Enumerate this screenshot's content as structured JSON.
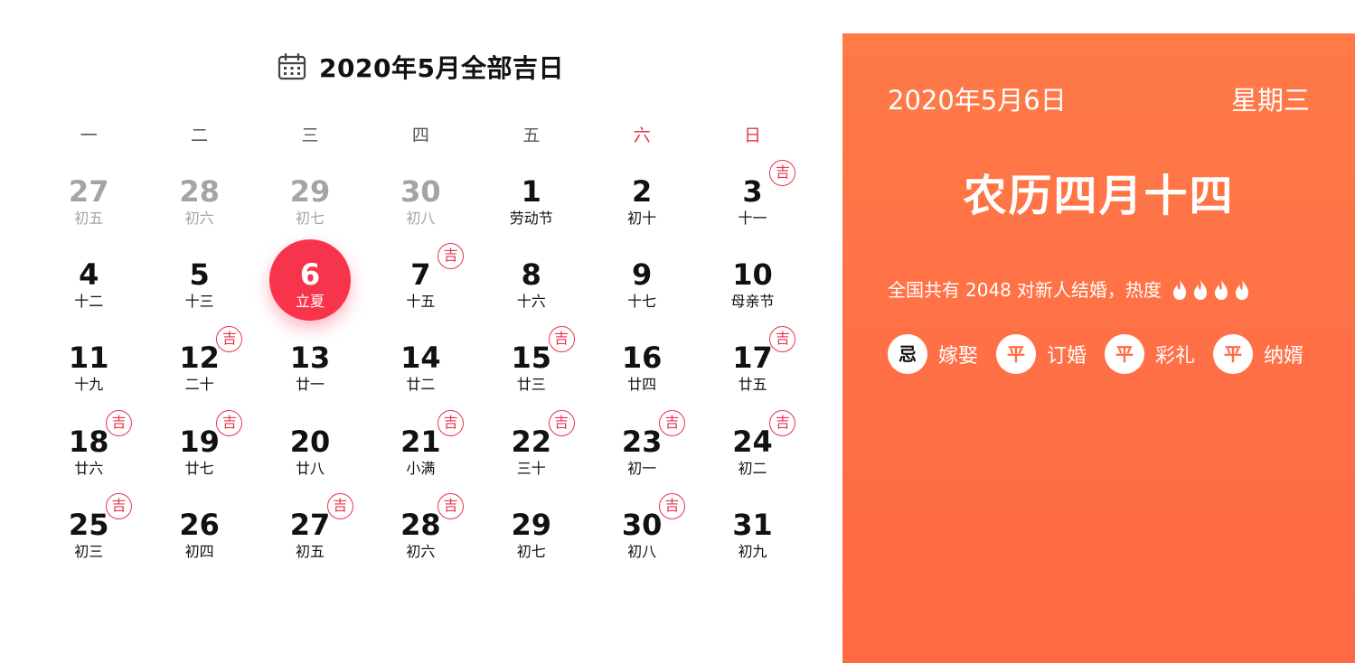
{
  "calendar": {
    "title": "2020年5月全部吉日",
    "weekdays": [
      "一",
      "二",
      "三",
      "四",
      "五",
      "六",
      "日"
    ],
    "ji_label": "吉",
    "days": [
      {
        "num": "27",
        "sub": "初五",
        "other": true,
        "ji": false
      },
      {
        "num": "28",
        "sub": "初六",
        "other": true,
        "ji": false
      },
      {
        "num": "29",
        "sub": "初七",
        "other": true,
        "ji": false
      },
      {
        "num": "30",
        "sub": "初八",
        "other": true,
        "ji": false
      },
      {
        "num": "1",
        "sub": "劳动节",
        "other": false,
        "ji": false
      },
      {
        "num": "2",
        "sub": "初十",
        "other": false,
        "ji": false
      },
      {
        "num": "3",
        "sub": "十一",
        "other": false,
        "ji": true
      },
      {
        "num": "4",
        "sub": "十二",
        "other": false,
        "ji": false
      },
      {
        "num": "5",
        "sub": "十三",
        "other": false,
        "ji": false
      },
      {
        "num": "6",
        "sub": "立夏",
        "other": false,
        "ji": false,
        "today": true
      },
      {
        "num": "7",
        "sub": "十五",
        "other": false,
        "ji": true
      },
      {
        "num": "8",
        "sub": "十六",
        "other": false,
        "ji": false
      },
      {
        "num": "9",
        "sub": "十七",
        "other": false,
        "ji": false
      },
      {
        "num": "10",
        "sub": "母亲节",
        "other": false,
        "ji": false
      },
      {
        "num": "11",
        "sub": "十九",
        "other": false,
        "ji": false
      },
      {
        "num": "12",
        "sub": "二十",
        "other": false,
        "ji": true
      },
      {
        "num": "13",
        "sub": "廿一",
        "other": false,
        "ji": false
      },
      {
        "num": "14",
        "sub": "廿二",
        "other": false,
        "ji": false
      },
      {
        "num": "15",
        "sub": "廿三",
        "other": false,
        "ji": true
      },
      {
        "num": "16",
        "sub": "廿四",
        "other": false,
        "ji": false
      },
      {
        "num": "17",
        "sub": "廿五",
        "other": false,
        "ji": true
      },
      {
        "num": "18",
        "sub": "廿六",
        "other": false,
        "ji": true
      },
      {
        "num": "19",
        "sub": "廿七",
        "other": false,
        "ji": true
      },
      {
        "num": "20",
        "sub": "廿八",
        "other": false,
        "ji": false
      },
      {
        "num": "21",
        "sub": "小满",
        "other": false,
        "ji": true
      },
      {
        "num": "22",
        "sub": "三十",
        "other": false,
        "ji": true
      },
      {
        "num": "23",
        "sub": "初一",
        "other": false,
        "ji": true
      },
      {
        "num": "24",
        "sub": "初二",
        "other": false,
        "ji": true
      },
      {
        "num": "25",
        "sub": "初三",
        "other": false,
        "ji": true
      },
      {
        "num": "26",
        "sub": "初四",
        "other": false,
        "ji": false
      },
      {
        "num": "27",
        "sub": "初五",
        "other": false,
        "ji": true
      },
      {
        "num": "28",
        "sub": "初六",
        "other": false,
        "ji": true
      },
      {
        "num": "29",
        "sub": "初七",
        "other": false,
        "ji": false
      },
      {
        "num": "30",
        "sub": "初八",
        "other": false,
        "ji": true
      },
      {
        "num": "31",
        "sub": "初九",
        "other": false,
        "ji": false
      }
    ]
  },
  "panel": {
    "date": "2020年5月6日",
    "weekday": "星期三",
    "lunar": "农历四月十四",
    "heat_prefix": "全国共有",
    "heat_count": "2048",
    "heat_suffix": "对新人结婚，热度",
    "flame_count": 4,
    "tags": [
      {
        "badge": "忌",
        "label": "嫁娶",
        "bad": true
      },
      {
        "badge": "平",
        "label": "订婚",
        "bad": false
      },
      {
        "badge": "平",
        "label": "彩礼",
        "bad": false
      },
      {
        "badge": "平",
        "label": "纳婿",
        "bad": false
      }
    ]
  },
  "colors": {
    "accent_red": "#f8344c",
    "ji_red": "#e8344e",
    "panel_orange": "#ff7048",
    "muted_gray": "#a4a4a4"
  },
  "icons": {
    "title_icon": "calendar-icon",
    "heat_icon": "flame-icon"
  }
}
